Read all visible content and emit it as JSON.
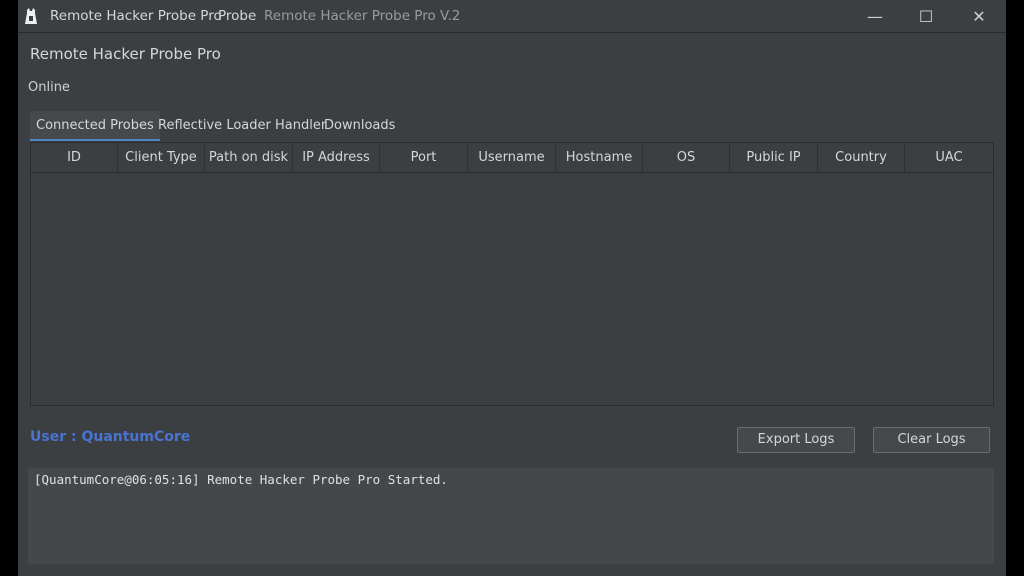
{
  "titlebar": {
    "app_name": "Remote Hacker Probe Pro",
    "subtitle": "Probe",
    "version": "Remote Hacker Probe Pro V.2",
    "icon": "app-logo-icon",
    "minimize_glyph": "—",
    "maximize_glyph": "☐",
    "close_glyph": "✕"
  },
  "header": {
    "title": "Remote Hacker Probe Pro",
    "status": "Online"
  },
  "tabs": [
    {
      "label": "Connected Probes",
      "active": true
    },
    {
      "label": "Reflective Loader Handler",
      "active": false
    },
    {
      "label": "Downloads",
      "active": false
    }
  ],
  "table": {
    "columns": [
      "ID",
      "Client Type",
      "Path on disk",
      "IP Address",
      "Port",
      "Username",
      "Hostname",
      "OS",
      "Public IP",
      "Country",
      "UAC"
    ],
    "rows": []
  },
  "footer": {
    "user_label": "User : QuantumCore",
    "export_label": "Export Logs",
    "clear_label": "Clear Logs"
  },
  "log": {
    "lines": [
      "[QuantumCore@06:05:16] Remote Hacker Probe Pro Started."
    ]
  },
  "colors": {
    "background": "#3c3f41",
    "accent": "#4a88c7",
    "user": "#4a74d1"
  }
}
